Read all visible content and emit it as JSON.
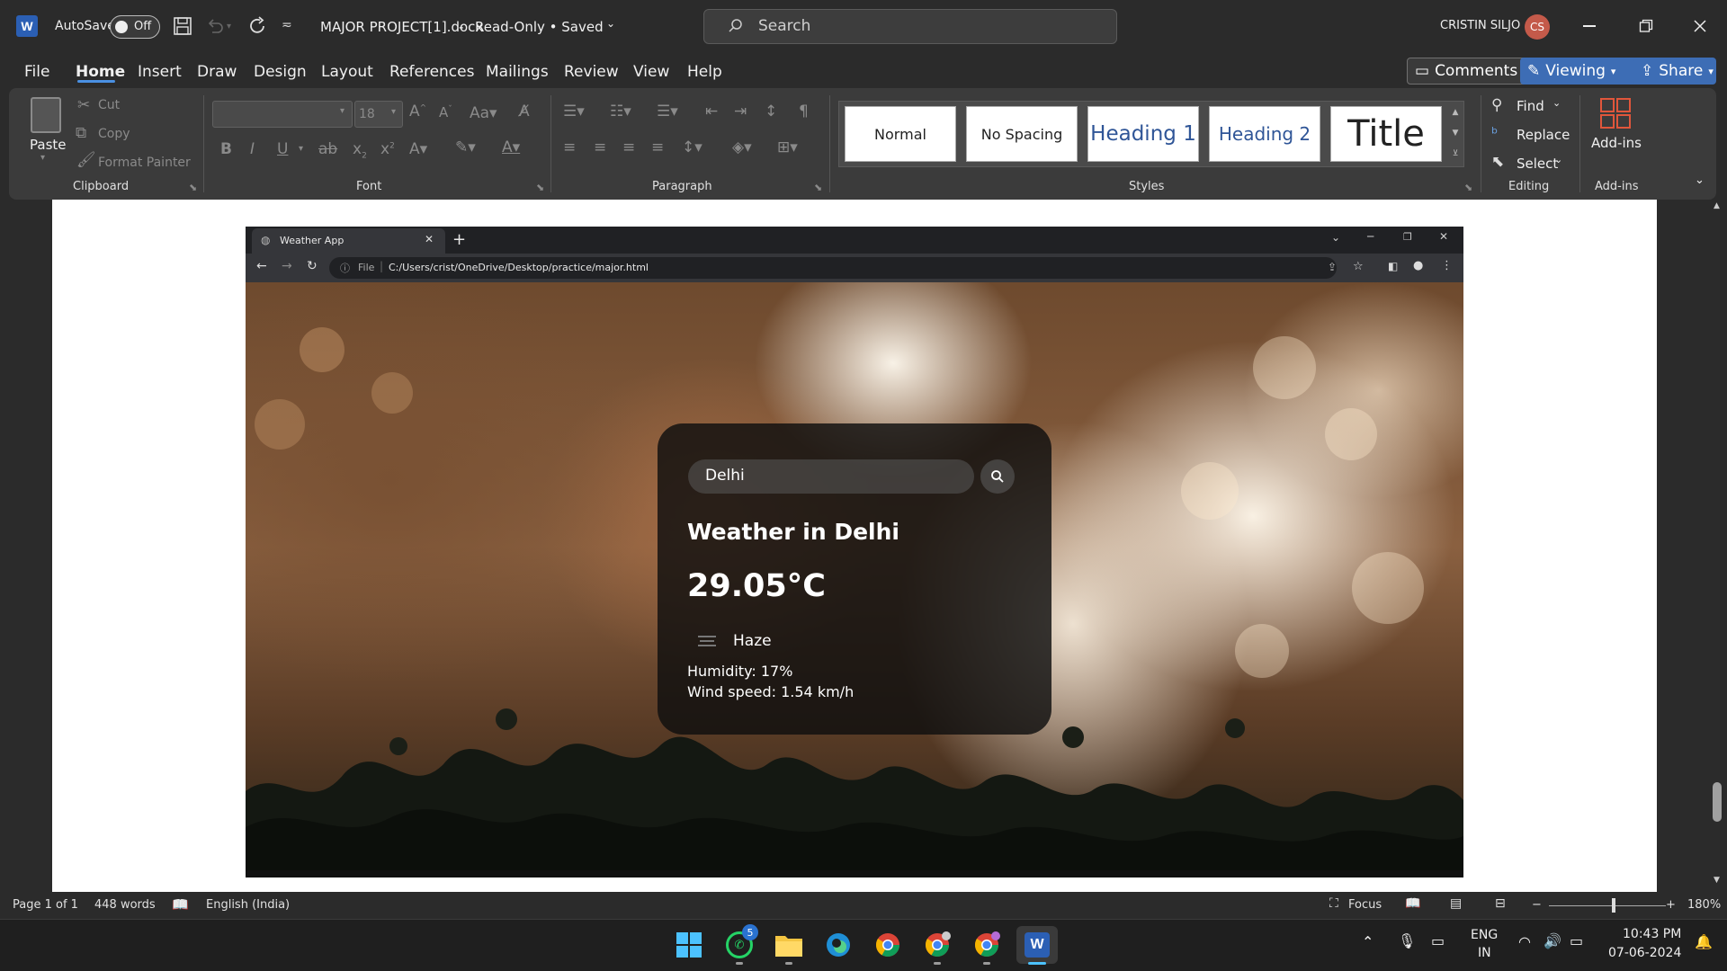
{
  "titlebar": {
    "autosave_label": "AutoSave",
    "autosave_state": "Off",
    "doc_title": "MAJOR PROJECT[1].docx",
    "doc_status": "Read-Only • Saved",
    "search_placeholder": "Search",
    "user_name": "CRISTIN SILJO",
    "user_initials": "CS"
  },
  "menu": {
    "items": [
      "File",
      "Home",
      "Insert",
      "Draw",
      "Design",
      "Layout",
      "References",
      "Mailings",
      "Review",
      "View",
      "Help"
    ],
    "active": "Home",
    "comments_label": "Comments",
    "viewing_label": "Viewing",
    "share_label": "Share"
  },
  "ribbon": {
    "clipboard": {
      "paste": "Paste",
      "cut": "Cut",
      "copy": "Copy",
      "format_painter": "Format Painter",
      "group_label": "Clipboard"
    },
    "font": {
      "size": "18",
      "group_label": "Font"
    },
    "paragraph": {
      "group_label": "Paragraph"
    },
    "styles": {
      "items": [
        "Normal",
        "No Spacing",
        "Heading 1",
        "Heading 2",
        "Title"
      ],
      "group_label": "Styles"
    },
    "editing": {
      "find": "Find",
      "replace": "Replace",
      "select": "Select",
      "group_label": "Editing"
    },
    "addins": {
      "label": "Add-ins",
      "group_label": "Add-ins"
    }
  },
  "browser": {
    "tab_title": "Weather App",
    "url_scheme": "File",
    "url": "C:/Users/crist/OneDrive/Desktop/practice/major.html"
  },
  "weather": {
    "search_value": "Delhi",
    "heading": "Weather in Delhi",
    "temperature": "29.05°C",
    "description": "Haze",
    "humidity": "Humidity: 17%",
    "wind": "Wind speed: 1.54 km/h"
  },
  "statusbar": {
    "page": "Page 1 of 1",
    "words": "448 words",
    "language": "English (India)",
    "focus": "Focus",
    "zoom": "180%"
  },
  "taskbar": {
    "whatsapp_badge": "5",
    "lang_line1": "ENG",
    "lang_line2": "IN",
    "time": "10:43 PM",
    "date": "07-06-2024"
  },
  "colors": {
    "accent_blue": "#4a90e2",
    "word_blue": "#2b5fb4",
    "avatar": "#c45a4a",
    "addins_orange": "#e0563b"
  }
}
